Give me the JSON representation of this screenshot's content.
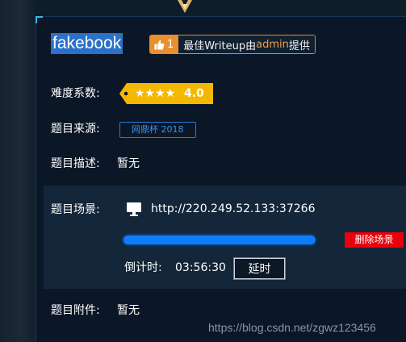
{
  "challenge": {
    "title": "fakebook"
  },
  "writeup_badge": {
    "like_count": "1",
    "text_prefix": "最佳Writeup由",
    "author": "admin",
    "text_suffix": "提供"
  },
  "difficulty": {
    "label": "难度系数:",
    "stars": "★★★★",
    "value": "4.0"
  },
  "source": {
    "label": "题目来源:",
    "value": "网鼎杯 2018"
  },
  "description": {
    "label": "题目描述:",
    "value": "暂无"
  },
  "scene": {
    "label": "题目场景:",
    "url": "http://220.249.52.133:37266",
    "progress": 0.99,
    "delete_label": "删除场景",
    "countdown_label": "倒计时:",
    "countdown_value": "03:56:30",
    "extend_label": "延时"
  },
  "attachment": {
    "label": "题目附件:",
    "value": "暂无"
  },
  "watermark": "https://blog.csdn.net/zgwz123456",
  "colors": {
    "accent_blue": "#0f7cff",
    "badge_orange": "#e8902f",
    "star_yellow": "#f5b800",
    "danger_red": "#e8000a"
  }
}
